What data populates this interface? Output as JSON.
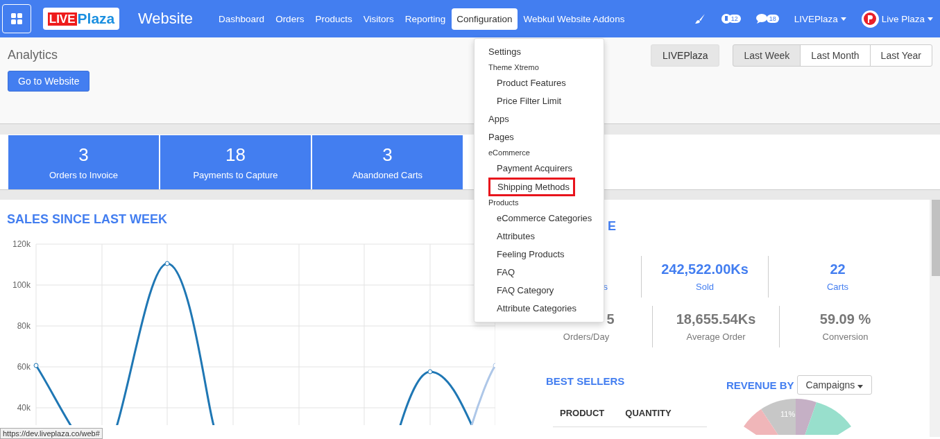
{
  "navbar": {
    "logo": {
      "part_1": "LIVE",
      "part_2": "Plaza"
    },
    "app_title": "Website",
    "menu": [
      {
        "label": "Dashboard",
        "selected": false
      },
      {
        "label": "Orders",
        "selected": false
      },
      {
        "label": "Products",
        "selected": false
      },
      {
        "label": "Visitors",
        "selected": false
      },
      {
        "label": "Reporting",
        "selected": false
      },
      {
        "label": "Configuration",
        "selected": true
      },
      {
        "label": "Webkul Website Addons",
        "selected": false
      }
    ],
    "activity_count": "12",
    "message_count": "18",
    "company": "LIVEPlaza",
    "user": "Live Plaza"
  },
  "control_panel": {
    "title": "Analytics",
    "go_button": "Go to Website",
    "website_filter": "LIVEPlaza",
    "periods": [
      {
        "label": "Last Week",
        "selected": true
      },
      {
        "label": "Last Month",
        "selected": false
      },
      {
        "label": "Last Year",
        "selected": false
      }
    ]
  },
  "tiles": [
    {
      "value": "3",
      "label": "Orders to Invoice"
    },
    {
      "value": "18",
      "label": "Payments to Capture"
    },
    {
      "value": "3",
      "label": "Abandoned Carts"
    }
  ],
  "sales": {
    "title": "SALES SINCE LAST WEEK",
    "y_axis_labels": [
      "120k",
      "100k",
      "80k",
      "60k",
      "40k"
    ]
  },
  "summary": {
    "title_fragment": "E",
    "top_stats": [
      {
        "label": "s"
      },
      {
        "value": "242,522.00Ks",
        "label": "Sold"
      },
      {
        "value": "22",
        "label": "Carts"
      }
    ],
    "bottom_stats": [
      {
        "value": "5",
        "label": "Orders/Day"
      },
      {
        "value": "18,655.54Ks",
        "label": "Average Order"
      },
      {
        "value": "59.09 %",
        "label": "Conversion"
      }
    ],
    "best_sellers": {
      "title": "BEST SELLERS",
      "columns": [
        "PRODUCT",
        "QUANTITY"
      ]
    },
    "revenue": {
      "title": "REVENUE BY",
      "group_by": "Campaigns",
      "pie_label": "11%"
    }
  },
  "config_menu": [
    {
      "kind": "link",
      "label": "Settings"
    },
    {
      "kind": "section",
      "label": "Theme Xtremo",
      "children": [
        {
          "label": "Product Features",
          "highlighted": false
        },
        {
          "label": "Price Filter Limit",
          "highlighted": false
        }
      ]
    },
    {
      "kind": "link",
      "label": "Apps"
    },
    {
      "kind": "link",
      "label": "Pages"
    },
    {
      "kind": "section",
      "label": "eCommerce",
      "children": [
        {
          "label": "Payment Acquirers",
          "highlighted": false
        },
        {
          "label": "Shipping Methods",
          "highlighted": true
        }
      ]
    },
    {
      "kind": "section",
      "label": "Products",
      "children": [
        {
          "label": "eCommerce Categories",
          "highlighted": false
        },
        {
          "label": "Attributes",
          "highlighted": false
        },
        {
          "label": "Feeling Products",
          "highlighted": false
        },
        {
          "label": "FAQ",
          "highlighted": false
        },
        {
          "label": "FAQ Category",
          "highlighted": false
        },
        {
          "label": "Attribute Categories",
          "highlighted": false
        }
      ]
    }
  ],
  "status_url": "https://dev.liveplaza.co/web#"
}
